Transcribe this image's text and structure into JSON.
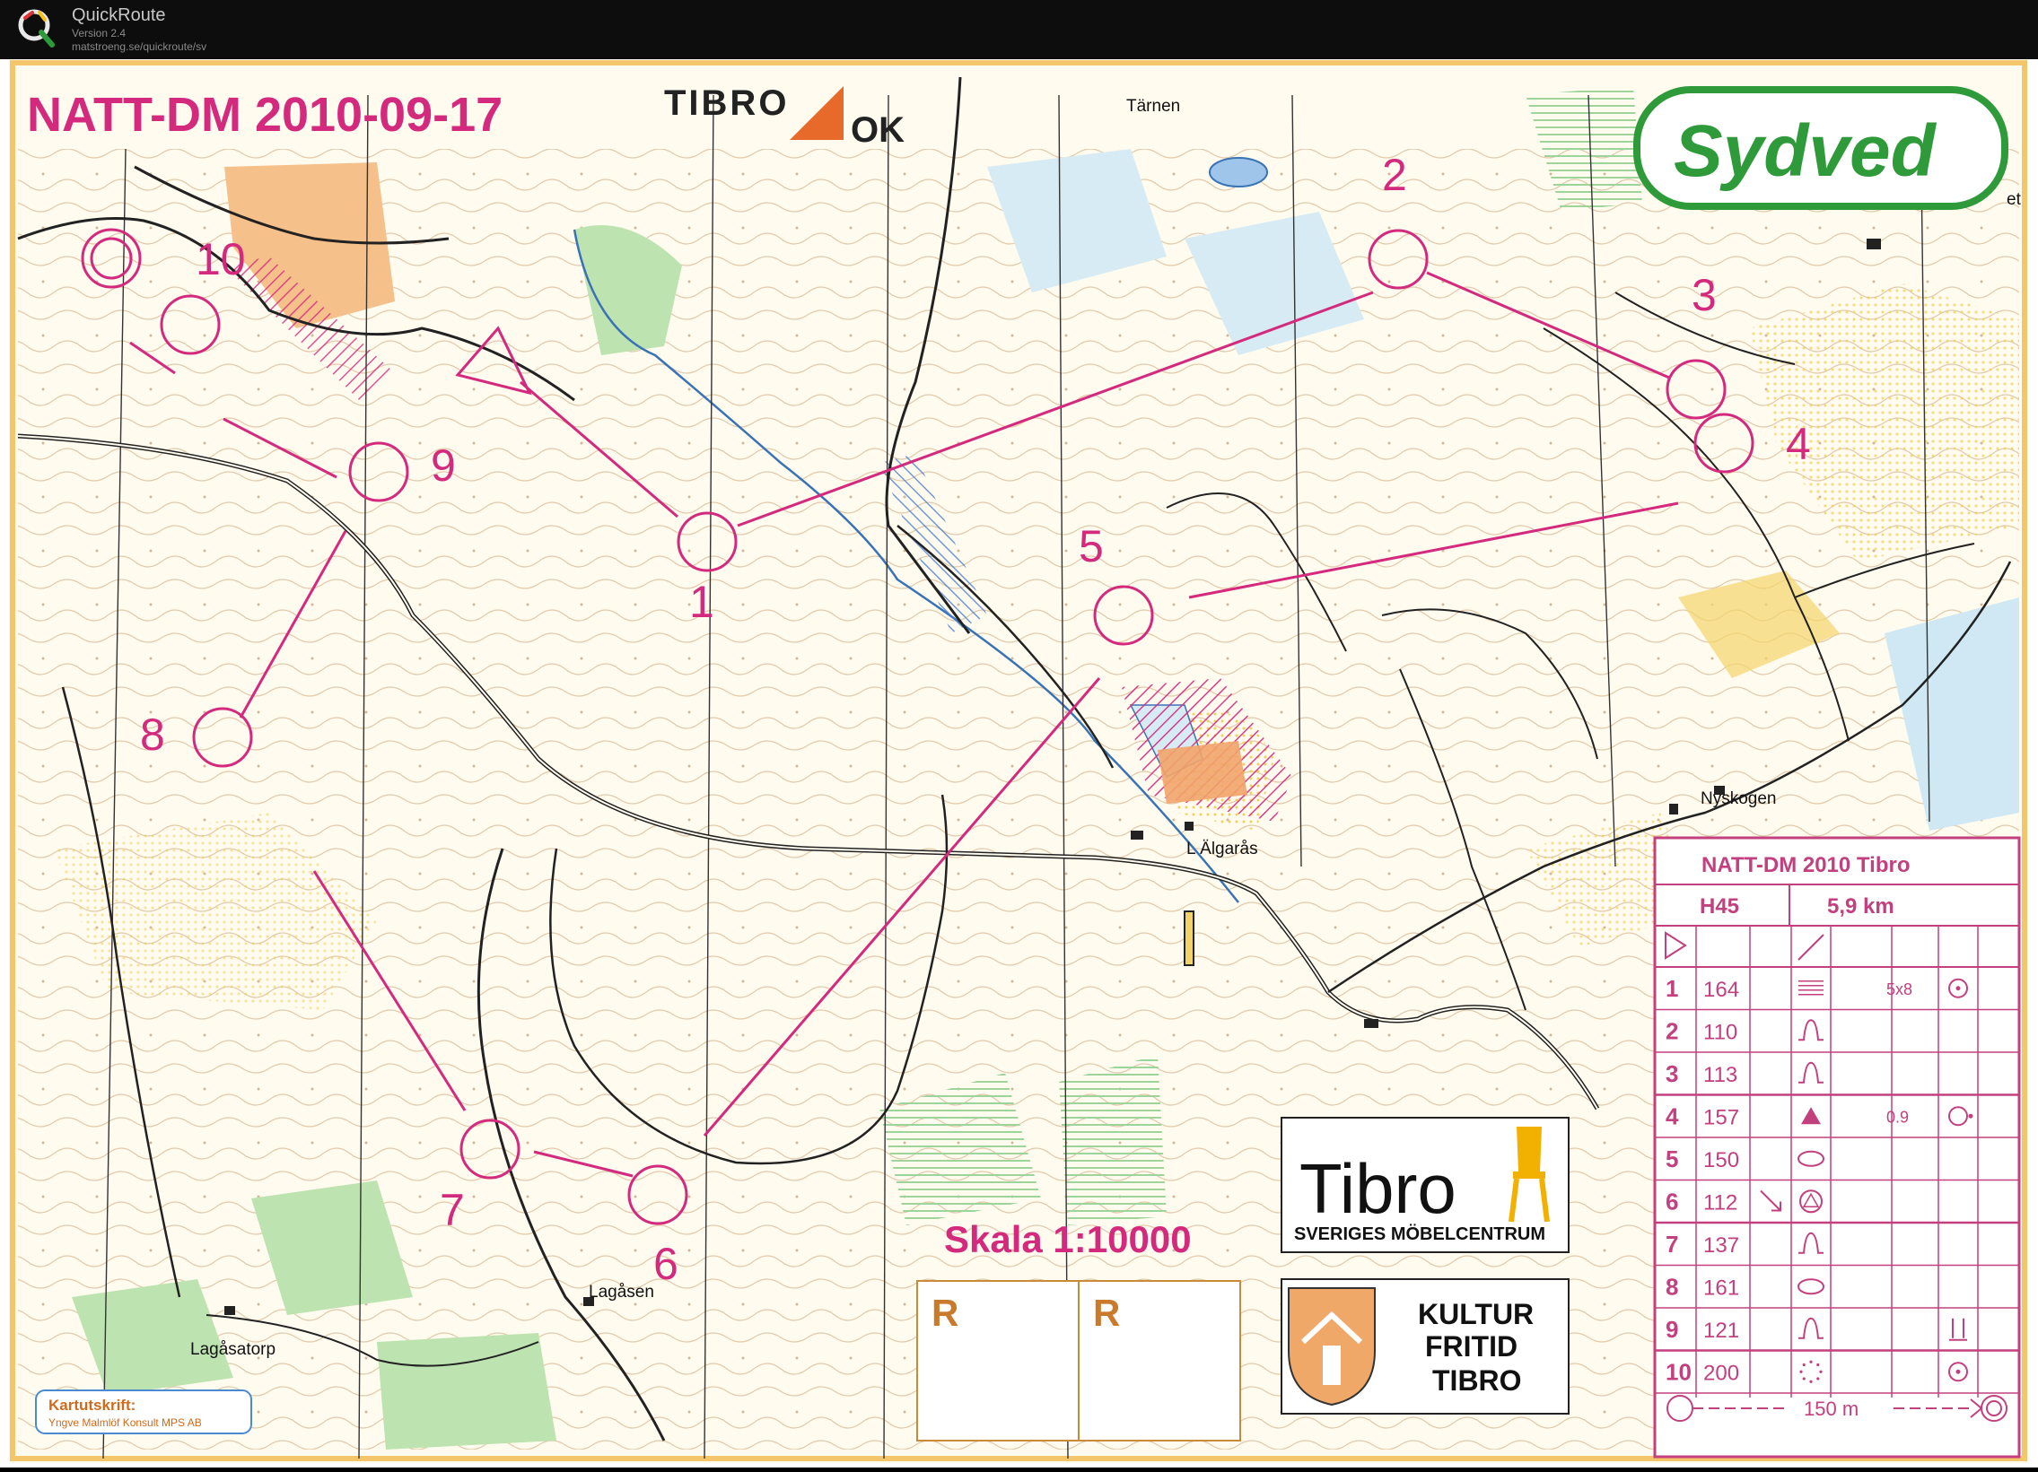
{
  "app": {
    "name": "QuickRoute",
    "version": "Version 2.4",
    "url": "matstroeng.se/quickroute/sv"
  },
  "map": {
    "event_title": "NATT-DM 2010-09-17",
    "club_logo": "TIBRO OK",
    "sponsor_logo": "Sydved",
    "scale_label": "Skala 1:10000",
    "reserved_marks": [
      "R",
      "R"
    ],
    "place_names": [
      "Tärnen",
      "L Älgarås",
      "Nyskogen",
      "Lagåsen",
      "Lagåsatorp"
    ],
    "edge_text": "et",
    "cartography_credit": {
      "heading": "Kartutskrift:",
      "text": "Yngve Malmlöf Konsult MPS AB"
    },
    "sponsor_tibro": {
      "name": "Tibro",
      "tagline": "SVERIGES MÖBELCENTRUM"
    },
    "sponsor_kultur": {
      "lines": [
        "KULTUR",
        "FRITID",
        "TIBRO"
      ]
    },
    "course_line_color": "#d42a7e",
    "control_labels": [
      "1",
      "2",
      "3",
      "4",
      "5",
      "6",
      "7",
      "8",
      "9",
      "10"
    ],
    "description_sheet": {
      "title": "NATT-DM 2010 Tibro",
      "class": "H45",
      "length": "5,9 km",
      "rows": [
        {
          "num": "1",
          "code": "164",
          "extra": "5x8"
        },
        {
          "num": "2",
          "code": "110",
          "extra": ""
        },
        {
          "num": "3",
          "code": "113",
          "extra": ""
        },
        {
          "num": "4",
          "code": "157",
          "extra": "0.9"
        },
        {
          "num": "5",
          "code": "150",
          "extra": ""
        },
        {
          "num": "6",
          "code": "112",
          "extra": ""
        },
        {
          "num": "7",
          "code": "137",
          "extra": ""
        },
        {
          "num": "8",
          "code": "161",
          "extra": ""
        },
        {
          "num": "9",
          "code": "121",
          "extra": ""
        },
        {
          "num": "10",
          "code": "200",
          "extra": ""
        }
      ],
      "finish_distance": "150 m"
    }
  }
}
